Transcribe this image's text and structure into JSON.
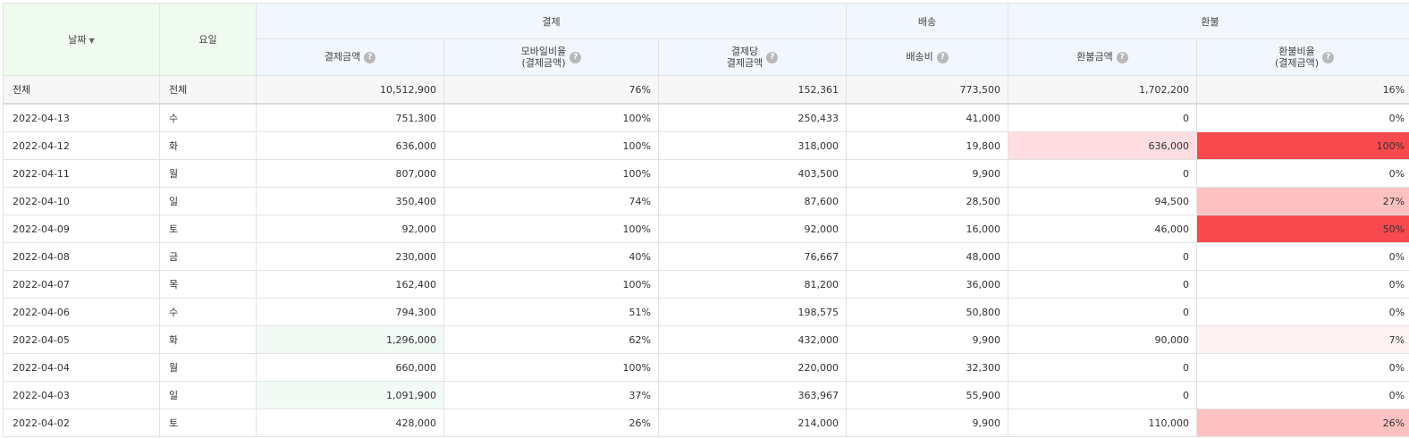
{
  "header": {
    "date": "날짜",
    "weekday": "요일",
    "groups": {
      "payment": "결제",
      "shipping": "배송",
      "refund": "환불"
    },
    "cols": {
      "pay_amount": "결제금액",
      "mobile_ratio_l1": "모바일비율",
      "mobile_ratio_l2": "(결제금액)",
      "per_pay_l1": "결제당",
      "per_pay_l2": "결제금액",
      "ship_fee": "배송비",
      "refund_amount": "환불금액",
      "refund_ratio_l1": "환불비율",
      "refund_ratio_l2": "(결제금액)"
    },
    "help_glyph": "?"
  },
  "total": {
    "date": "전체",
    "weekday": "전체",
    "pay": "10,512,900",
    "mobile": "76%",
    "per": "152,361",
    "ship": "773,500",
    "refund": "1,702,200",
    "ratio": "16%"
  },
  "rows": [
    {
      "date": "2022-04-13",
      "weekday": "수",
      "pay": "751,300",
      "mobile": "100%",
      "per": "250,433",
      "ship": "41,000",
      "refund": "0",
      "ratio": "0%"
    },
    {
      "date": "2022-04-12",
      "weekday": "화",
      "pay": "636,000",
      "mobile": "100%",
      "per": "318,000",
      "ship": "19,800",
      "refund": "636,000",
      "ratio": "100%"
    },
    {
      "date": "2022-04-11",
      "weekday": "월",
      "pay": "807,000",
      "mobile": "100%",
      "per": "403,500",
      "ship": "9,900",
      "refund": "0",
      "ratio": "0%"
    },
    {
      "date": "2022-04-10",
      "weekday": "일",
      "pay": "350,400",
      "mobile": "74%",
      "per": "87,600",
      "ship": "28,500",
      "refund": "94,500",
      "ratio": "27%"
    },
    {
      "date": "2022-04-09",
      "weekday": "토",
      "pay": "92,000",
      "mobile": "100%",
      "per": "92,000",
      "ship": "16,000",
      "refund": "46,000",
      "ratio": "50%"
    },
    {
      "date": "2022-04-08",
      "weekday": "금",
      "pay": "230,000",
      "mobile": "40%",
      "per": "76,667",
      "ship": "48,000",
      "refund": "0",
      "ratio": "0%"
    },
    {
      "date": "2022-04-07",
      "weekday": "목",
      "pay": "162,400",
      "mobile": "100%",
      "per": "81,200",
      "ship": "36,000",
      "refund": "0",
      "ratio": "0%"
    },
    {
      "date": "2022-04-06",
      "weekday": "수",
      "pay": "794,300",
      "mobile": "51%",
      "per": "198,575",
      "ship": "50,800",
      "refund": "0",
      "ratio": "0%"
    },
    {
      "date": "2022-04-05",
      "weekday": "화",
      "pay": "1,296,000",
      "mobile": "62%",
      "per": "432,000",
      "ship": "9,900",
      "refund": "90,000",
      "ratio": "7%"
    },
    {
      "date": "2022-04-04",
      "weekday": "월",
      "pay": "660,000",
      "mobile": "100%",
      "per": "220,000",
      "ship": "32,300",
      "refund": "0",
      "ratio": "0%"
    },
    {
      "date": "2022-04-03",
      "weekday": "일",
      "pay": "1,091,900",
      "mobile": "37%",
      "per": "363,967",
      "ship": "55,900",
      "refund": "0",
      "ratio": "0%"
    },
    {
      "date": "2022-04-02",
      "weekday": "토",
      "pay": "428,000",
      "mobile": "26%",
      "per": "214,000",
      "ship": "9,900",
      "refund": "110,000",
      "ratio": "26%"
    }
  ],
  "heat_colors": {
    "pay_high": "#f2faf5",
    "refund_high": "#ffdde0",
    "ratio_100": "#f84a4e",
    "ratio_50": "#f84a4e",
    "ratio_27": "#ffc0c2",
    "ratio_26": "#ffc0c2",
    "ratio_7": "#fff3f4"
  }
}
